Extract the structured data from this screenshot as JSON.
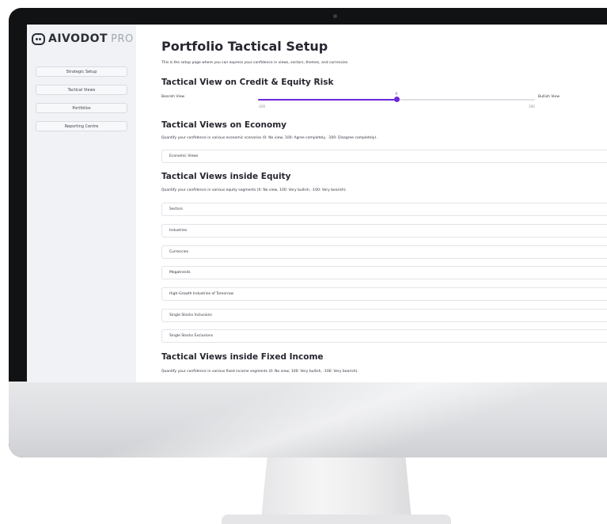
{
  "brand": {
    "name": "AIVODOT",
    "suffix": "PRO"
  },
  "sidebar": {
    "items": [
      {
        "label": "Strategic Setup"
      },
      {
        "label": "Tactical Views"
      },
      {
        "label": "Portfolios"
      },
      {
        "label": "Reporting Centre"
      }
    ]
  },
  "page": {
    "title": "Portfolio Tactical Setup",
    "description": "This is the setup page where you can express your confidence in views, sectors, themes, and currencies"
  },
  "credit_equity": {
    "title": "Tactical View on Credit & Equity Risk",
    "left_label": "Bearish View",
    "right_label": "Bullish View",
    "value": "0",
    "min_label": "-100",
    "max_label": "100",
    "value_fraction": 0.5,
    "accent_color": "#6d28d9"
  },
  "economy": {
    "title": "Tactical Views on Economy",
    "description": "Quantify your confidence in various economic scenarios (0: No view, 100: Agree completely, -100: Disagree completely).",
    "expanders": [
      {
        "label": "Economic Views"
      }
    ]
  },
  "equity": {
    "title": "Tactical Views inside Equity",
    "description": "Quantify your confidence in various equity segments (0: No view, 100: Very bullish, -100: Very bearish).",
    "expanders": [
      {
        "label": "Sectors"
      },
      {
        "label": "Industries"
      },
      {
        "label": "Currencies"
      },
      {
        "label": "Megatrends"
      },
      {
        "label": "High-Growth Industries of Tomorrow"
      },
      {
        "label": "Single Stocks Inclusions"
      },
      {
        "label": "Single Stocks Exclusions"
      }
    ]
  },
  "fixed_income": {
    "title": "Tactical Views inside Fixed Income",
    "description": "Quantify your confidence in various fixed income segments (0: No view, 100: Very bullish, -100: Very bearish)."
  }
}
